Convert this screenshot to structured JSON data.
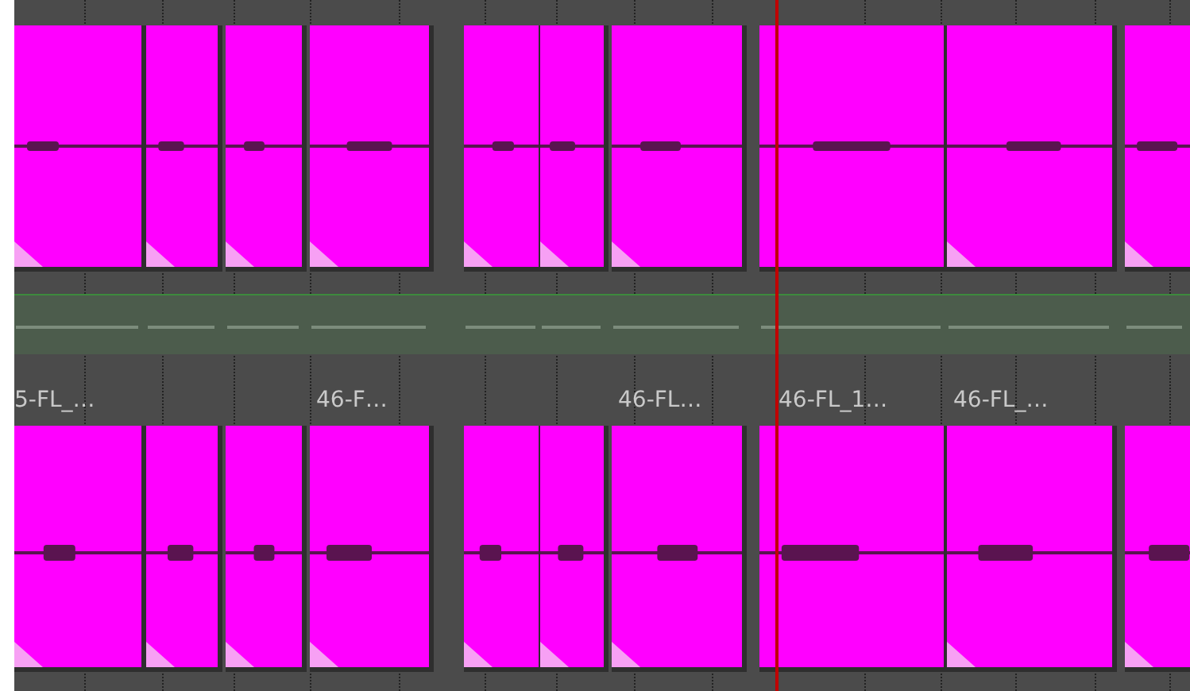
{
  "tracks": [
    {
      "clips": [
        {
          "kind": "audio"
        },
        {
          "kind": "audio"
        },
        {
          "kind": "audio"
        },
        {
          "kind": "audio"
        },
        {
          "kind": "audio"
        },
        {
          "kind": "audio"
        },
        {
          "kind": "audio"
        },
        {
          "kind": "audio"
        },
        {
          "kind": "audio"
        },
        {
          "kind": "audio"
        }
      ]
    },
    {
      "clips": [
        {
          "kind": "audio",
          "label": "5-FL_…"
        },
        {
          "kind": "audio"
        },
        {
          "kind": "audio"
        },
        {
          "kind": "audio",
          "label": "46-F…"
        },
        {
          "kind": "audio"
        },
        {
          "kind": "audio"
        },
        {
          "kind": "audio",
          "label": "46-FL…"
        },
        {
          "kind": "audio",
          "label": "46-FL_1…"
        },
        {
          "kind": "audio",
          "label": "46-FL_…"
        },
        {
          "kind": "audio"
        }
      ]
    }
  ]
}
